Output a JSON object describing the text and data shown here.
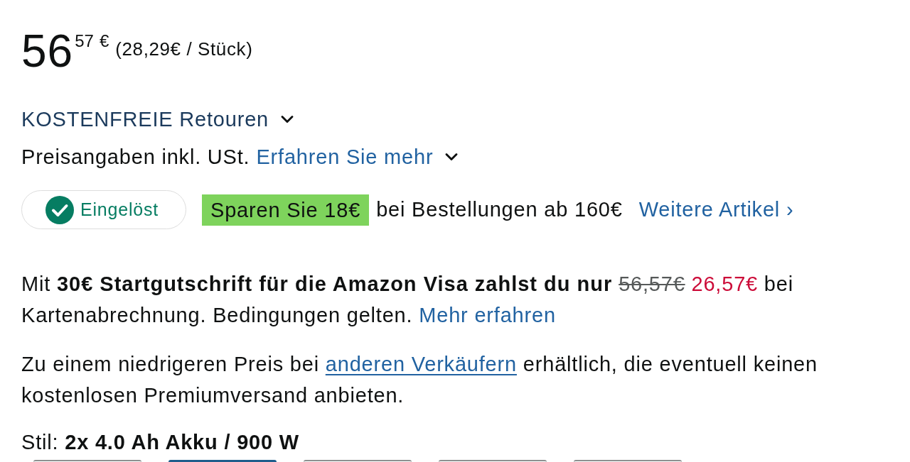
{
  "price": {
    "whole": "56",
    "fraction": "57",
    "currency": "€",
    "unit_price": "(28,29€ / Stück)"
  },
  "returns": {
    "label": "KOSTENFREIE Retouren"
  },
  "tax_note": {
    "text": "Preisangaben inkl. USt.",
    "link": "Erfahren Sie mehr"
  },
  "coupon": {
    "status": "Eingelöst",
    "redeemed": true,
    "badge": "Sparen Sie 18€",
    "condition": "bei Bestellungen ab 160€",
    "link": "Weitere Artikel ›"
  },
  "visa_offer": {
    "lead": "Mit **30€ Startgutschrift für die Amazon Visa zahlst du nur**",
    "old_price": "56,57€",
    "new_price": "26,57€",
    "tail": "bei Kartenabrechnung. Bedingungen gelten.",
    "link": "Mehr erfahren"
  },
  "other_sellers": {
    "before": "Zu einem niedrigeren Preis bei",
    "link": "anderen Verkäufern",
    "after": "erhältlich, die eventuell keinen kostenlosen Premiumversand anbieten."
  },
  "style": {
    "label": "Stil: **2x 4.0 Ah Akku / 900 W**",
    "options": [
      {
        "selected": false
      },
      {
        "selected": true
      },
      {
        "selected": false
      },
      {
        "selected": false
      },
      {
        "selected": false
      }
    ]
  }
}
